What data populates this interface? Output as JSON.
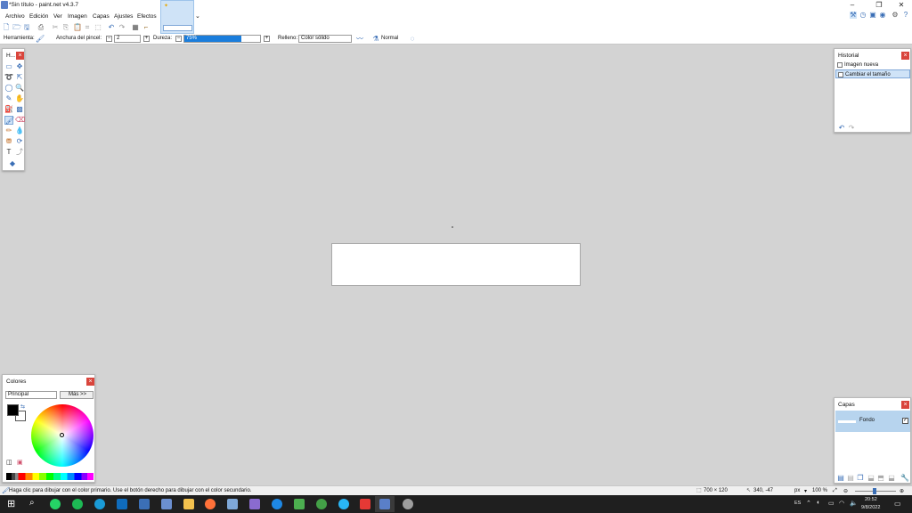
{
  "window": {
    "title": "*Sin título - paint.net v4.3.7",
    "minimize": "–",
    "maximize": "❐",
    "close": "✕"
  },
  "menu": {
    "items": [
      "Archivo",
      "Edición",
      "Ver",
      "Imagen",
      "Capas",
      "Ajustes",
      "Efectos"
    ]
  },
  "toolbar": {
    "herramienta_label": "Herramienta:",
    "anchura_label": "Anchura del pincel:",
    "anchura_value": "2",
    "dureza_label": "Dureza:",
    "dureza_value": "75%",
    "dureza_fraction": 0.75,
    "relleno_label": "Relleno:",
    "relleno_value": "Color sólido",
    "blend_value": "Normal"
  },
  "tools_panel": {
    "title": "H..."
  },
  "history_panel": {
    "title": "Historial",
    "items": [
      {
        "label": "Imagen nueva",
        "selected": false
      },
      {
        "label": "Cambiar el tamaño",
        "selected": true
      }
    ]
  },
  "colors_panel": {
    "title": "Colores",
    "mode": "Principal",
    "more_button": "Más >>",
    "primary": "#000000",
    "secondary": "#ffffff"
  },
  "layers_panel": {
    "title": "Capas",
    "layers": [
      {
        "name": "Fondo",
        "visible": true
      }
    ]
  },
  "status": {
    "hint": "Haga clic para dibujar con el color primario. Use el botón derecho para dibujar con el color secundario.",
    "image_size": "700 × 120",
    "cursor_pos": "340, -47",
    "unit": "px",
    "zoom": "100 %"
  },
  "taskbar": {
    "lang": "ES",
    "time": "20:52",
    "date": "9/8/2022"
  },
  "colors": {
    "accent": "#1a7ddc",
    "selection": "#cfe3f7",
    "close_red": "#d9453c",
    "taskbar": "#1f1f1f",
    "workspace": "#d3d3d3"
  }
}
